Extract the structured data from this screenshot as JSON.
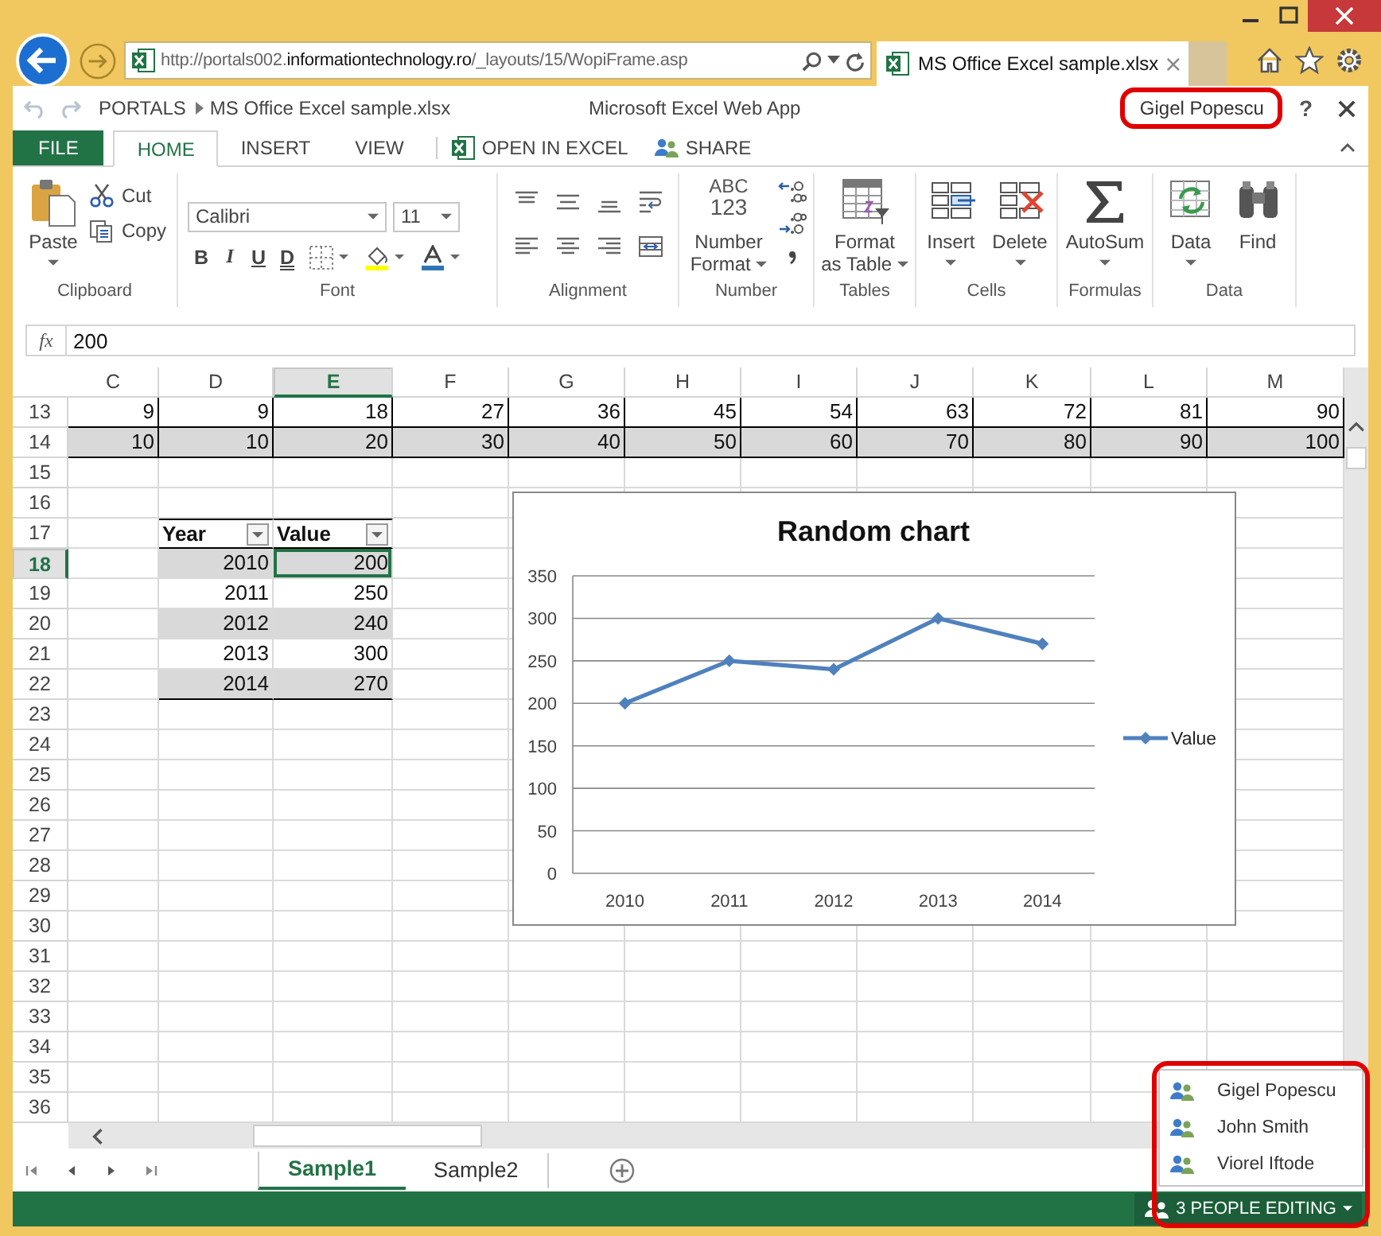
{
  "browser": {
    "url_start": "http://portals002.",
    "url_domain": "informationtechnology.ro",
    "url_rest": "/_layouts/15/WopiFrame.asp",
    "tab_title": "MS Office Excel sample.xlsx"
  },
  "app_bar": {
    "breadcrumb": [
      "PORTALS",
      "MS Office Excel sample.xlsx"
    ],
    "title": "Microsoft Excel Web App",
    "user": "Gigel Popescu",
    "user_highlighted": true,
    "help": "?"
  },
  "ribbon_tabs": [
    {
      "label": "FILE",
      "kind": "file",
      "selected": false
    },
    {
      "label": "HOME",
      "kind": "tab",
      "selected": true
    },
    {
      "label": "INSERT",
      "kind": "tab",
      "selected": false
    },
    {
      "label": "VIEW",
      "kind": "tab",
      "selected": false
    },
    {
      "label": "OPEN IN EXCEL",
      "kind": "open_in_excel",
      "selected": false
    },
    {
      "label": "SHARE",
      "kind": "share",
      "selected": false
    }
  ],
  "ribbon": {
    "clipboard": {
      "label": "Clipboard",
      "paste": "Paste",
      "cut": "Cut",
      "copy": "Copy"
    },
    "font": {
      "label": "Font",
      "family": "Calibri",
      "size": "11",
      "bold": "B",
      "italic": "I",
      "underline": "U",
      "double_underline": "D"
    },
    "alignment": {
      "label": "Alignment"
    },
    "number": {
      "label": "Number",
      "icon_text": [
        "ABC",
        "123"
      ],
      "button": [
        "Number",
        "Format"
      ]
    },
    "tables": {
      "label": "Tables",
      "button": [
        "Format",
        "as Table"
      ]
    },
    "cells": {
      "label": "Cells",
      "insert": "Insert",
      "delete": "Delete"
    },
    "formulas": {
      "label": "Formulas",
      "autosum": "AutoSum"
    },
    "data": {
      "label": "Data",
      "data": "Data",
      "find": "Find"
    }
  },
  "formula_bar": {
    "label": "fx",
    "value": "200"
  },
  "sheet": {
    "columns": [
      {
        "name": "C",
        "selected": false
      },
      {
        "name": "D",
        "selected": false
      },
      {
        "name": "E",
        "selected": true
      },
      {
        "name": "F",
        "selected": false
      },
      {
        "name": "G",
        "selected": false
      },
      {
        "name": "H",
        "selected": false
      },
      {
        "name": "I",
        "selected": false
      },
      {
        "name": "J",
        "selected": false
      },
      {
        "name": "K",
        "selected": false
      },
      {
        "name": "L",
        "selected": false
      },
      {
        "name": "M",
        "selected": false
      }
    ],
    "rows": [
      {
        "number": "13",
        "selected": false,
        "shaded": false,
        "cells": [
          "9",
          "9",
          "18",
          "27",
          "36",
          "45",
          "54",
          "63",
          "72",
          "81",
          "90"
        ]
      },
      {
        "number": "14",
        "selected": false,
        "shaded": true,
        "cells": [
          "10",
          "10",
          "20",
          "30",
          "40",
          "50",
          "60",
          "70",
          "80",
          "90",
          "100"
        ]
      },
      {
        "number": "15",
        "selected": false
      },
      {
        "number": "16",
        "selected": false
      },
      {
        "number": "17",
        "selected": false
      },
      {
        "number": "18",
        "selected": true
      },
      {
        "number": "19",
        "selected": false
      },
      {
        "number": "20",
        "selected": false
      },
      {
        "number": "21",
        "selected": false
      },
      {
        "number": "22",
        "selected": false
      },
      {
        "number": "23",
        "selected": false
      },
      {
        "number": "24",
        "selected": false
      },
      {
        "number": "25",
        "selected": false
      },
      {
        "number": "26",
        "selected": false
      },
      {
        "number": "27",
        "selected": false
      },
      {
        "number": "28",
        "selected": false
      },
      {
        "number": "29",
        "selected": false
      },
      {
        "number": "30",
        "selected": false
      },
      {
        "number": "31",
        "selected": false
      },
      {
        "number": "32",
        "selected": false
      },
      {
        "number": "33",
        "selected": false
      },
      {
        "number": "34",
        "selected": false
      },
      {
        "number": "35",
        "selected": false
      },
      {
        "number": "36",
        "selected": false
      }
    ],
    "table": {
      "header": [
        "Year",
        "Value"
      ],
      "rows": [
        {
          "year": "2010",
          "value": "200",
          "shaded": true
        },
        {
          "year": "2011",
          "value": "250",
          "shaded": false
        },
        {
          "year": "2012",
          "value": "240",
          "shaded": true
        },
        {
          "year": "2013",
          "value": "300",
          "shaded": false
        },
        {
          "year": "2014",
          "value": "270",
          "shaded": true
        }
      ]
    },
    "chart": {
      "chart_data": {
        "type": "line",
        "title": "Random chart",
        "categories": [
          "2010",
          "2011",
          "2012",
          "2013",
          "2014"
        ],
        "series": [
          {
            "name": "Value",
            "color": "#4f81bd",
            "marker": "diamond",
            "values": [
              200,
              250,
              240,
              300,
              270
            ]
          }
        ],
        "ylim": [
          0,
          350
        ],
        "yticks": [
          0,
          50,
          100,
          150,
          200,
          250,
          300,
          350
        ],
        "grid": true
      }
    }
  },
  "sheet_tabs": [
    {
      "label": "Sample1",
      "selected": true
    },
    {
      "label": "Sample2",
      "selected": false
    }
  ],
  "editors": {
    "expanded": true,
    "highlighted": true,
    "people": [
      "Gigel Popescu",
      "John Smith",
      "Viorel Iftode"
    ],
    "button": "3 PEOPLE EDITING"
  }
}
